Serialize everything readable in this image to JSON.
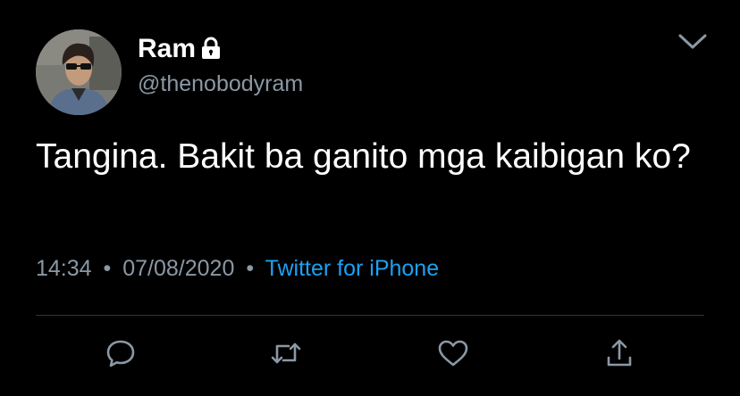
{
  "tweet": {
    "author": {
      "display_name": "Ram",
      "handle": "@thenobodyram",
      "avatar_icon": "profile-photo",
      "protected_icon": "lock-icon"
    },
    "text": "Tangina. Bakit ba ganito mga kaibigan ko?",
    "time": "14:34",
    "date": "07/08/2020",
    "separator": "•",
    "source": "Twitter for iPhone"
  },
  "actions": {
    "reply_icon": "reply-icon",
    "retweet_icon": "retweet-icon",
    "like_icon": "heart-icon",
    "share_icon": "share-icon"
  },
  "colors": {
    "background": "#000000",
    "text": "#ffffff",
    "secondary": "#8b98a5",
    "accent": "#1da1f2",
    "divider": "#2f3336"
  }
}
